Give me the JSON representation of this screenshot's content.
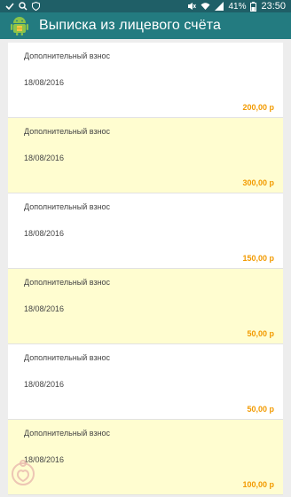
{
  "status_bar": {
    "battery": "41%",
    "time": "23:50"
  },
  "app_bar": {
    "title": "Выписка из лицевого счёта"
  },
  "transactions": [
    {
      "title": "Дополнительный взнос",
      "date": "18/08/2016",
      "amount": "200,00 р"
    },
    {
      "title": "Дополнительный взнос",
      "date": "18/08/2016",
      "amount": "300,00 р"
    },
    {
      "title": "Дополнительный взнос",
      "date": "18/08/2016",
      "amount": "150,00 р"
    },
    {
      "title": "Дополнительный взнос",
      "date": "18/08/2016",
      "amount": "50,00 р"
    },
    {
      "title": "Дополнительный взнос",
      "date": "18/08/2016",
      "amount": "50,00 р"
    },
    {
      "title": "Дополнительный взнос",
      "date": "18/08/2016",
      "amount": "100,00 р"
    }
  ],
  "colors": {
    "status_bar": "#1f5f67",
    "app_bar": "#237b80",
    "card_white": "#ffffff",
    "card_highlight": "#fffdd0",
    "amount": "#f29a00"
  }
}
